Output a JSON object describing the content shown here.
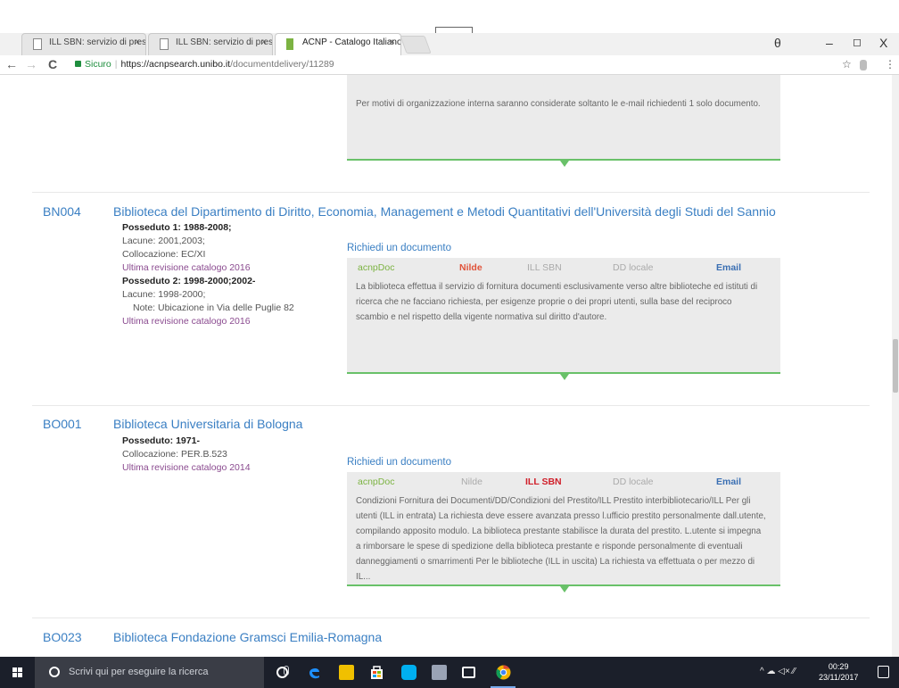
{
  "browser": {
    "tabs": [
      {
        "label": "ILL SBN: servizio di prest"
      },
      {
        "label": "ILL SBN: servizio di prest"
      },
      {
        "label": "ACNP - Catalogo Italiano"
      }
    ],
    "tab_close": "×",
    "window_controls": {
      "profile": "θ",
      "minimize": "–",
      "maximize": "◻",
      "close": "X"
    },
    "nav": {
      "back": "←",
      "forward": "→",
      "reload": "C"
    },
    "secure_label": "Sicuro",
    "url_host": "https://acnpsearch.unibo.it",
    "url_path": "/documentdelivery/11289",
    "star_icon": "☆",
    "menu_icon": "⋮"
  },
  "page": {
    "top_panel_text": "Per motivi di organizzazione interna saranno considerate soltanto le e-mail richiedenti 1 solo documento.",
    "request_label": "Richiedi un documento",
    "libraries": [
      {
        "code": "BN004",
        "name": "Biblioteca del Dipartimento di Diritto, Economia, Management e Metodi Quantitativi dell'Università degli Studi del Sannio",
        "holdings": [
          {
            "type": "title",
            "text": "Posseduto 1: 1988-2008;"
          },
          {
            "type": "plain",
            "text": "Lacune: 2001,2003;"
          },
          {
            "type": "plain",
            "text": "Collocazione: EC/XI"
          },
          {
            "type": "rev",
            "text": "Ultima revisione catalogo 2016"
          },
          {
            "type": "title",
            "text": "Posseduto 2: 1998-2000;2002-"
          },
          {
            "type": "plain",
            "text": "Lacune: 1998-2000;"
          },
          {
            "type": "note",
            "text": "Note: Ubicazione in Via delle Puglie 82"
          },
          {
            "type": "rev",
            "text": "Ultima revisione catalogo 2016"
          }
        ],
        "methods": [
          "acnpDoc",
          "Nilde",
          "ILL SBN",
          "DD locale",
          "Email"
        ],
        "panel_lines": [
          "La biblioteca effettua il servizio di fornitura documenti esclusivamente verso altre biblioteche ed istituti di",
          "ricerca che ne facciano richiesta, per esigenze proprie o dei propri utenti, sulla base del reciproco",
          "scambio e nel rispetto della vigente normativa sul diritto d'autore."
        ]
      },
      {
        "code": "BO001",
        "name": "Biblioteca Universitaria di Bologna",
        "holdings": [
          {
            "type": "title",
            "text": "Posseduto: 1971-"
          },
          {
            "type": "plain",
            "text": "Collocazione: PER.B.523"
          },
          {
            "type": "rev",
            "text": "Ultima revisione catalogo 2014"
          }
        ],
        "methods": [
          "acnpDoc",
          "Nilde",
          "ILL SBN",
          "DD locale",
          "Email"
        ],
        "panel_lines": [
          "Condizioni Fornitura dei Documenti/DD/Condizioni del Prestito/ILL Prestito interbibliotecario/ILL Per gli",
          "utenti (ILL in entrata) La richiesta deve essere avanzata presso l.ufficio prestito personalmente dall.utente,",
          "compilando apposito modulo. La biblioteca prestante stabilisce la durata del prestito. L.utente si impegna",
          "a rimborsare le spese di spedizione della biblioteca prestante e risponde personalmente di eventuali",
          "danneggiamenti o smarrimenti Per le biblioteche (ILL in uscita) La richiesta va effettuata o per mezzo di IL..."
        ]
      },
      {
        "code": "BO023",
        "name": "Biblioteca Fondazione Gramsci Emilia-Romagna"
      }
    ]
  },
  "taskbar": {
    "search_placeholder": "Scrivi qui per eseguire la ricerca",
    "tray": "^ ☁ ◁× ⁄⁄",
    "time": "00:29",
    "date": "23/11/2017",
    "colors": {
      "edge": "#1e90ff",
      "explorer": "#f0c000",
      "store": "#ffffff",
      "skype": "#00aff0",
      "chrome": "#f4b400"
    }
  }
}
